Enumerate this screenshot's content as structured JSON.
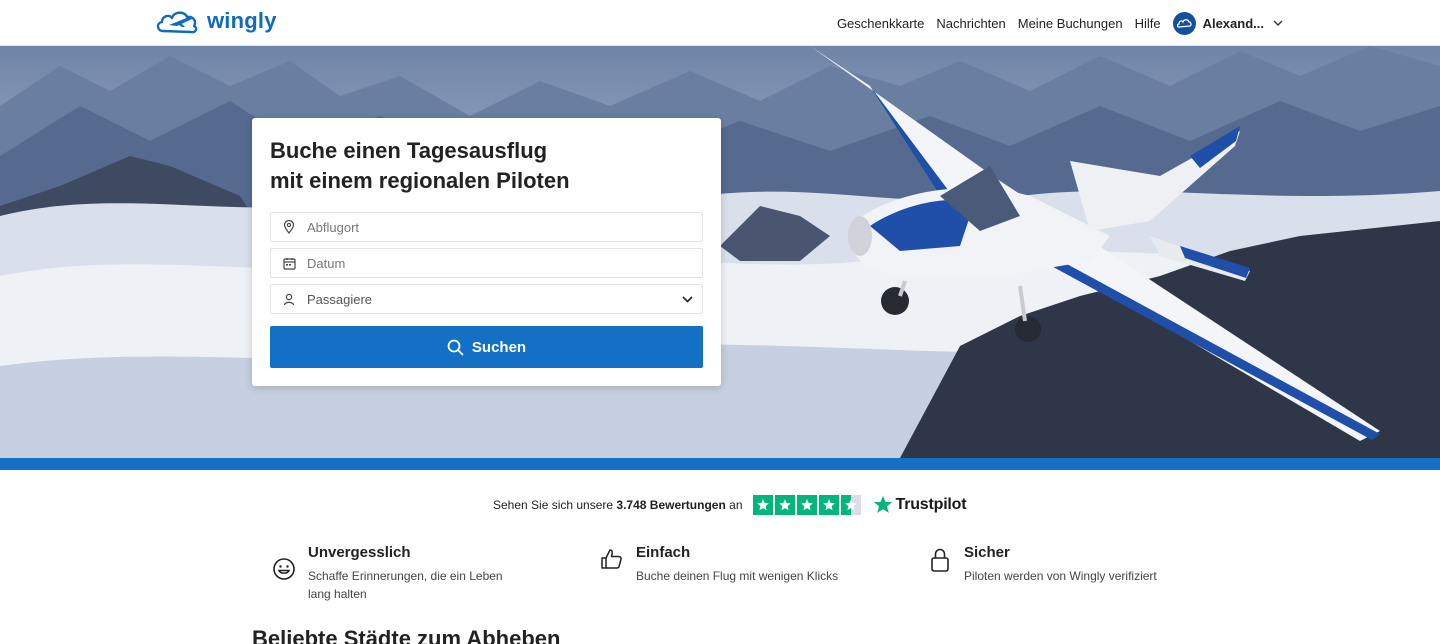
{
  "brand": {
    "name": "wingly"
  },
  "nav": {
    "links": [
      "Geschenkkarte",
      "Nachrichten",
      "Meine Buchungen",
      "Hilfe"
    ],
    "user_name": "Alexand..."
  },
  "search": {
    "title_line1": "Buche einen Tagesausflug",
    "title_line2": "mit einem regionalen Piloten",
    "departure_placeholder": "Abflugort",
    "date_placeholder": "Datum",
    "passengers_label": "Passagiere",
    "button_label": "Suchen"
  },
  "trustpilot": {
    "prefix": "Sehen Sie sich unsere",
    "count": "3.748 Bewertungen",
    "suffix": "an",
    "brand": "Trustpilot",
    "rating_stars": 4.5
  },
  "features": [
    {
      "title": "Unvergesslich",
      "description": "Schaffe Erinnerungen, die ein Leben lang halten",
      "icon": "smiley-icon"
    },
    {
      "title": "Einfach",
      "description": "Buche deinen Flug mit wenigen Klicks",
      "icon": "thumbs-up-icon"
    },
    {
      "title": "Sicher",
      "description": "Piloten werden von Wingly verifiziert",
      "icon": "lock-icon"
    }
  ],
  "popular": {
    "title": "Beliebte Städte zum Abheben"
  },
  "colors": {
    "brand_blue": "#1370c4",
    "trustpilot_green": "#00b67a"
  }
}
